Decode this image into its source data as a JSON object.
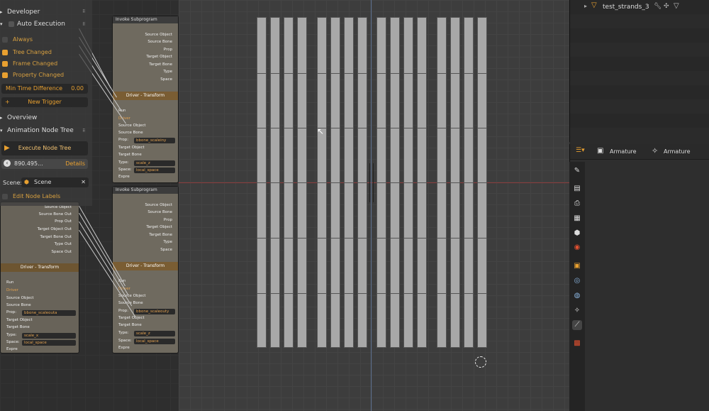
{
  "sidebar": {
    "developer_label": "Developer",
    "auto_execution": {
      "title": "Auto Execution",
      "options": [
        {
          "label": "Always",
          "checked": false
        },
        {
          "label": "Tree Changed",
          "checked": true
        },
        {
          "label": "Frame Changed",
          "checked": true
        },
        {
          "label": "Property Changed",
          "checked": true
        }
      ],
      "min_time_label": "Min Time Difference",
      "min_time_value": "0.00",
      "new_trigger_label": "New Trigger"
    },
    "overview_label": "Overview",
    "animation_tree": {
      "title": "Animation Node Tree",
      "execute_label": "Execute Node Tree",
      "time_value": "890.495...",
      "details_label": "Details",
      "scene_prefix": "Scene:",
      "scene_value": "Scene",
      "edit_labels": "Edit Node Labels"
    }
  },
  "nodes": {
    "invoke_subprogram_title": "Invoke Subprogram",
    "invoke_sockets": [
      "Source Object",
      "Source Bone",
      "Prop",
      "Target Object",
      "Target Bone",
      "Type",
      "Space"
    ],
    "driver_title": "Driver - Transform",
    "driver_rows": [
      "Run",
      "Driver",
      "Source Object",
      "Source Bone"
    ],
    "prop_label": "Prop:",
    "target_rows": [
      "Target Object",
      "Target Bone"
    ],
    "type_label": "Type:",
    "space_label": "Space:",
    "expr_label": "Expre",
    "driver_1": {
      "prop": "bbone_scaleiny",
      "type": "scale_z",
      "space": "local_space"
    },
    "driver_2": {
      "prop": "bbone_scaleouty",
      "type": "scale_z",
      "space": "local_space"
    },
    "driver_left": {
      "prop": "bbone_scaleouta",
      "type": "scale_x",
      "space": "local_space"
    },
    "out_sockets": [
      "Source Object",
      "Source Bone Out",
      "Prop Out",
      "Target Object Out",
      "Target Bone Out",
      "Type Out",
      "Space Out"
    ]
  },
  "outliner": {
    "item_label": "test_strands_3"
  },
  "properties": {
    "object_name": "Armature",
    "data_name": "Armature"
  },
  "colors": {
    "accent": "#e8a030",
    "x_axis": "#c94141",
    "y_axis": "#5b7fb5"
  }
}
